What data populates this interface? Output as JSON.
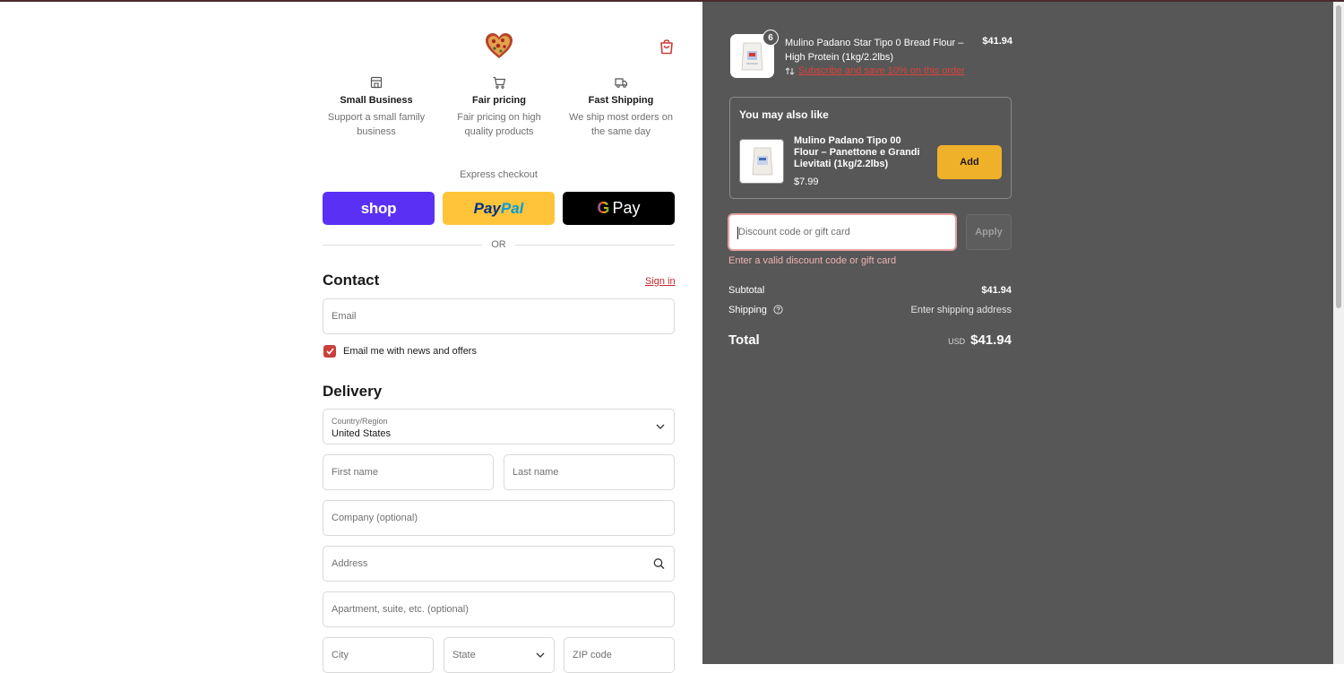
{
  "features": [
    {
      "icon": "storefront-icon",
      "title": "Small Business",
      "desc_line1": "Support a small family",
      "desc_line2": "business"
    },
    {
      "icon": "shopping-cart-icon",
      "title": "Fair pricing",
      "desc_line1": "Fair pricing on high",
      "desc_line2": "quality products"
    },
    {
      "icon": "delivery-truck-icon",
      "title": "Fast Shipping",
      "desc_line1": "We ship most orders on",
      "desc_line2": "the same day"
    }
  ],
  "express": {
    "label": "Express checkout",
    "shop_label": "shop",
    "paypal_part1": "Pay",
    "paypal_part2": "Pal",
    "gpay_g": "G",
    "gpay_label": "Pay",
    "or_label": "OR"
  },
  "contact": {
    "title": "Contact",
    "sign_in": "Sign in",
    "email_placeholder": "Email",
    "newsletter_label": "Email me with news and offers",
    "newsletter_checked": true
  },
  "delivery": {
    "title": "Delivery",
    "country_label": "Country/Region",
    "country_value": "United States",
    "first_name": "First name",
    "last_name": "Last name",
    "company": "Company (optional)",
    "address": "Address",
    "apartment": "Apartment, suite, etc. (optional)",
    "city": "City",
    "state": "State",
    "zip": "ZIP code"
  },
  "order": {
    "quantity": "6",
    "product_name": "Mulino Padano Star Tipo 0 Bread Flour – High Protein (1kg/2.2lbs)",
    "product_price": "$41.94",
    "subscribe_text": "Subscribe and save 10% on this order"
  },
  "upsell": {
    "title": "You may also like",
    "name": "Mulino Padano Tipo 00 Flour – Panettone e Grandi Lievitati (1kg/2.2lbs)",
    "price": "$7.99",
    "add_label": "Add"
  },
  "discount": {
    "placeholder": "Discount code or gift card",
    "apply_label": "Apply",
    "error": "Enter a valid discount code or gift card"
  },
  "summary": {
    "subtotal_label": "Subtotal",
    "subtotal_value": "$41.94",
    "shipping_label": "Shipping",
    "shipping_value": "Enter shipping address",
    "total_label": "Total",
    "currency": "USD",
    "total_value": "$41.94"
  },
  "colors": {
    "accent": "#c9403c",
    "summary_bg": "#575757",
    "shop_pay": "#5a31f4",
    "paypal": "#ffc439",
    "add_button": "#f0b12a"
  }
}
